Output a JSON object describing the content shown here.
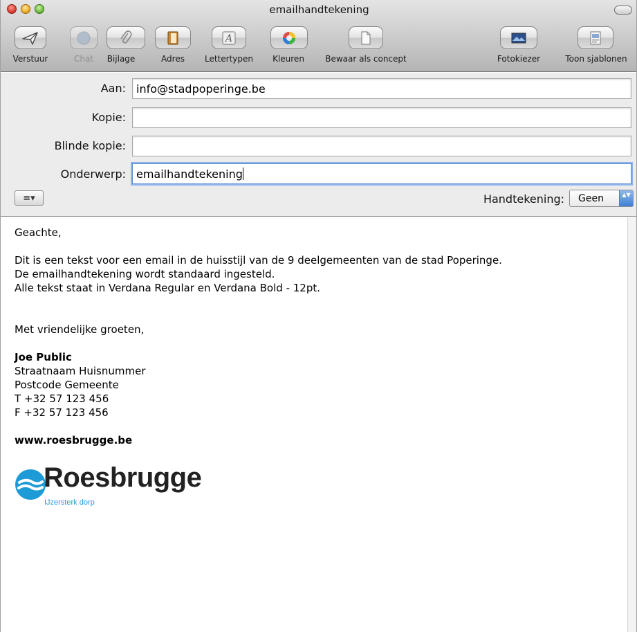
{
  "window": {
    "title": "emailhandtekening"
  },
  "toolbar": {
    "items": [
      {
        "label": "Verstuur",
        "icon": "send-icon",
        "enabled": true
      },
      {
        "label": "Chat",
        "icon": "chat-icon",
        "enabled": false
      },
      {
        "label": "Bijlage",
        "icon": "paperclip-icon",
        "enabled": true
      },
      {
        "label": "Adres",
        "icon": "address-book-icon",
        "enabled": true
      },
      {
        "label": "Lettertypen",
        "icon": "fonts-icon",
        "enabled": true
      },
      {
        "label": "Kleuren",
        "icon": "color-wheel-icon",
        "enabled": true
      },
      {
        "label": "Bewaar als concept",
        "icon": "draft-icon",
        "enabled": true
      },
      {
        "label": "Fotokiezer",
        "icon": "photo-browser-icon",
        "enabled": true
      },
      {
        "label": "Toon sjablonen",
        "icon": "templates-icon",
        "enabled": true
      }
    ]
  },
  "headers": {
    "to": {
      "label": "Aan:",
      "value": "info@stadpoperinge.be"
    },
    "cc": {
      "label": "Kopie:",
      "value": ""
    },
    "bcc": {
      "label": "Blinde kopie:",
      "value": ""
    },
    "subject": {
      "label": "Onderwerp:",
      "value": "emailhandtekening"
    },
    "menu_glyph": "≡▾",
    "signature": {
      "label": "Handtekening:",
      "value": "Geen",
      "arrows": "▲▼"
    }
  },
  "message": {
    "greeting": "Geachte,",
    "lines": [
      "Dit is een tekst voor een email in de huisstijl van de 9 deelgemeenten van de stad Poperinge.",
      "De emailhandtekening wordt standaard ingesteld.",
      "Alle tekst staat in Verdana Regular en Verdana Bold - 12pt."
    ],
    "closing": "Met vriendelijke groeten,",
    "name": "Joe Public",
    "address1": "Straatnaam Huisnummer",
    "address2": "Postcode Gemeente",
    "phone": "T +32 57 123 456",
    "fax": "F +32 57 123 456",
    "website": "www.roesbrugge.be",
    "logo": {
      "name": "Roesbrugge",
      "tagline": "IJzersterk dorp",
      "color": "#1d9bd7"
    }
  }
}
